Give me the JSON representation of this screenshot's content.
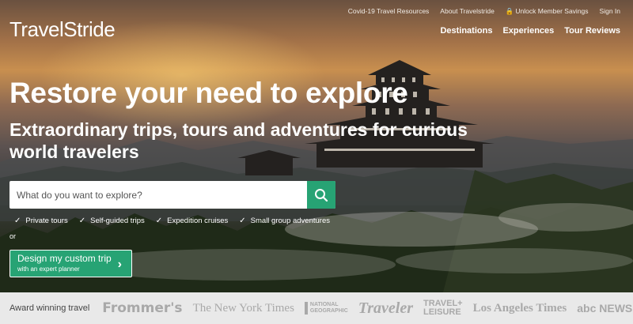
{
  "header": {
    "logo_text": "TravelStride",
    "utility_links": [
      "Covid-19 Travel Resources",
      "About Travelstride",
      "Unlock Member Savings",
      "Sign In"
    ],
    "nav": [
      "Destinations",
      "Experiences",
      "Tour Reviews"
    ]
  },
  "hero": {
    "headline": "Restore your need to explore",
    "subhead": "Extraordinary trips, tours and adventures for curious world travelers"
  },
  "search": {
    "placeholder": "What do you want to explore?"
  },
  "features": [
    "Private tours",
    "Self-guided trips",
    "Expedition cruises",
    "Small group adventures"
  ],
  "or_text": "or",
  "cta": {
    "title": "Design my custom trip",
    "subtitle": "with an expert planner"
  },
  "press": {
    "label": "Award winning travel",
    "logos": [
      "Frommer's",
      "The New York Times",
      "NATIONAL GEOGRAPHIC",
      "Traveler",
      "TRAVEL+ LEISURE",
      "Los Angeles Times",
      "abc NEWS"
    ]
  },
  "colors": {
    "accent": "#27a374",
    "press_bar": "#e9e9e9"
  }
}
